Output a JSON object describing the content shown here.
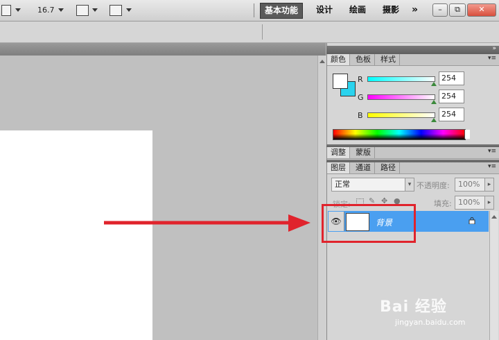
{
  "toolbar": {
    "zoom_value": "16.7",
    "workspaces": [
      "基本功能",
      "设计",
      "绘画",
      "摄影"
    ],
    "more": "»"
  },
  "window_buttons": {
    "minimize": "–",
    "restore": "⧉",
    "close": "✕"
  },
  "color_panel": {
    "tabs": [
      "颜色",
      "色板",
      "样式"
    ],
    "channels": [
      {
        "label": "R",
        "value": "254"
      },
      {
        "label": "G",
        "value": "254"
      },
      {
        "label": "B",
        "value": "254"
      }
    ]
  },
  "adjust_panel": {
    "tabs": [
      "调整",
      "蒙版"
    ]
  },
  "layers_panel": {
    "tabs": [
      "图层",
      "通道",
      "路径"
    ],
    "blend_mode": "正常",
    "opacity_label": "不透明度:",
    "opacity_value": "100%",
    "lock_label": "锁定:",
    "fill_label": "填充:",
    "fill_value": "100%",
    "layers": [
      {
        "name": "背景"
      }
    ]
  },
  "watermark": {
    "text": "Bai 经验",
    "url": "jingyan.baidu.com"
  },
  "colors": {
    "accent_red": "#e0232c",
    "selected_layer": "#4a9ff0",
    "background_swatch": "#2ad3ee"
  }
}
